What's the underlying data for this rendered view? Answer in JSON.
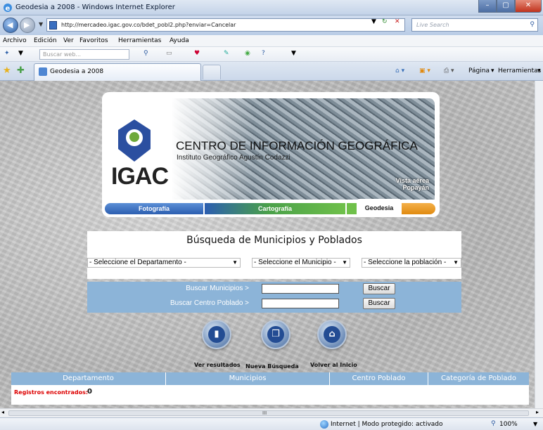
{
  "window": {
    "title": "Geodesia a 2008 - Windows Internet Explorer",
    "url": "http://mercadeo.igac.gov.co/bdet_pobl2.php?enviar=Cancelar",
    "search_placeholder": "Live Search"
  },
  "menu": [
    "Archivo",
    "Edición",
    "Ver",
    "Favoritos",
    "Herramientas",
    "Ayuda"
  ],
  "toolbar": {
    "search_placeholder": "Buscar web..."
  },
  "tab": {
    "label": "Geodesia a 2008"
  },
  "right_tools": {
    "pagina": "Página",
    "herramientas": "Herramientas"
  },
  "banner": {
    "logo_text": "IGAC",
    "title": "CENTRO DE INFORMACIÓN GEOGRÁFICA",
    "subtitle": "Instituto Geográfico Agustín Codazzi",
    "caption_line1": "Vista aérea",
    "caption_line2": "Popayán",
    "tabs": {
      "fotografia": "Fotografía",
      "cartografia": "Cartografía",
      "geodesia": "Geodesia"
    }
  },
  "search": {
    "title": "Búsqueda de Municipios y Poblados",
    "select_departamento": "- Seleccione el Departamento -",
    "select_municipio": "- Seleccione el Municipio -",
    "select_poblacion": "- Seleccione la población -",
    "buscar_municipios_label": "Buscar Municipios  >",
    "buscar_centro_label": "Buscar Centro Poblado  >",
    "buscar_button": "Buscar"
  },
  "actions": {
    "ver_resultados": "Ver resultados",
    "nueva_busqueda": "Nueva Búsqueda",
    "volver_inicio": "Volver al Inicio"
  },
  "results": {
    "columns": [
      "Departamento",
      "Municipios",
      "Centro Poblado",
      "Categoría de Poblado"
    ],
    "found_label": "Registros encontrados:",
    "found_count": "0"
  },
  "status": {
    "text": "Internet | Modo protegido: activado",
    "zoom": "100%"
  }
}
